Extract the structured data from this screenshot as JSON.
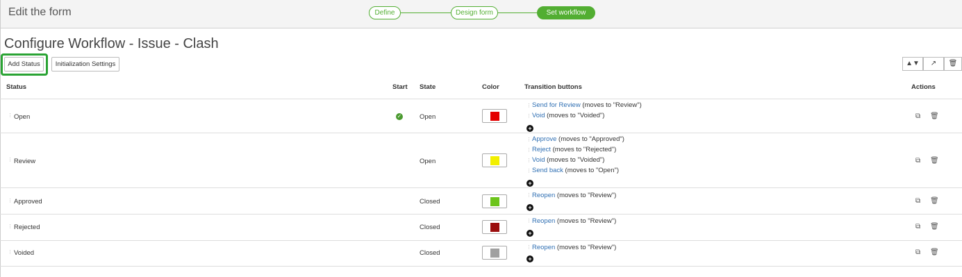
{
  "header": {
    "title": "Edit the form",
    "steps": [
      "Define",
      "Design form",
      "Set workflow"
    ]
  },
  "page": {
    "title": "Configure Workflow - Issue - Clash"
  },
  "toolbar": {
    "add_status": "Add Status",
    "init_settings": "Initialization Settings"
  },
  "columns": {
    "status": "Status",
    "start": "Start",
    "state": "State",
    "color": "Color",
    "transitions": "Transition buttons",
    "actions": "Actions"
  },
  "rows": [
    {
      "status": "Open",
      "start": true,
      "state": "Open",
      "color": "#e40000",
      "transitions": [
        {
          "label": "Send for Review",
          "moves": " (moves to \"Review\")"
        },
        {
          "label": "Void",
          "moves": " (moves to \"Voided\")"
        }
      ]
    },
    {
      "status": "Review",
      "start": false,
      "state": "Open",
      "color": "#f2ef00",
      "transitions": [
        {
          "label": "Approve",
          "moves": " (moves to \"Approved\")"
        },
        {
          "label": "Reject",
          "moves": " (moves to \"Rejected\")"
        },
        {
          "label": "Void",
          "moves": " (moves to \"Voided\")"
        },
        {
          "label": "Send back",
          "moves": " (moves to \"Open\")"
        }
      ]
    },
    {
      "status": "Approved",
      "start": false,
      "state": "Closed",
      "color": "#6cc41b",
      "transitions": [
        {
          "label": "Reopen",
          "moves": " (moves to \"Review\")"
        }
      ]
    },
    {
      "status": "Rejected",
      "start": false,
      "state": "Closed",
      "color": "#9b0e0e",
      "transitions": [
        {
          "label": "Reopen",
          "moves": " (moves to \"Review\")"
        }
      ]
    },
    {
      "status": "Voided",
      "start": false,
      "state": "Closed",
      "color": "#a0a0a0",
      "transitions": [
        {
          "label": "Reopen",
          "moves": " (moves to \"Review\")"
        }
      ]
    }
  ]
}
